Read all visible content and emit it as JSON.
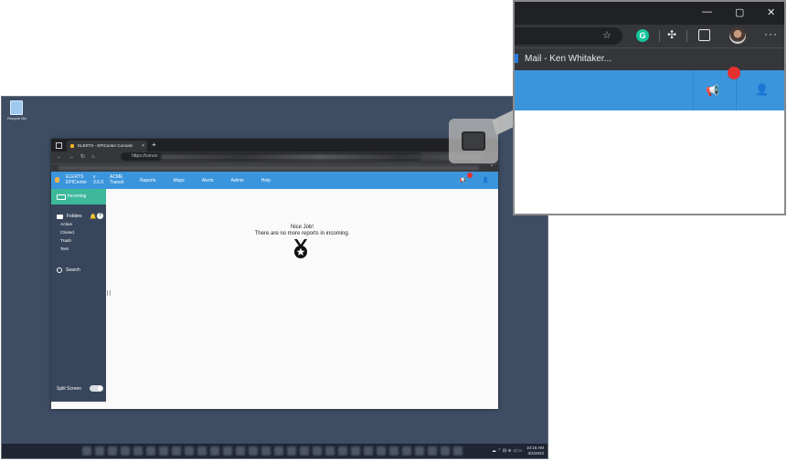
{
  "desktop": {
    "recycle_bin": "Recycle Bin",
    "clock_time": "10:16 AM",
    "clock_date": "3/4/2022"
  },
  "browser": {
    "tab_title": "ELERTS - EPICenter Console",
    "tab_close": "×",
    "new_tab": "+",
    "nav_glyphs": "←→↻⌂",
    "url": "https://conso"
  },
  "app": {
    "brand_line1": "ELERTS",
    "brand_line2": "EPICenter",
    "version_line1": "v",
    "version_line2": "3.6.0",
    "tenant_line1": "ACME",
    "tenant_line2": "Transit",
    "menu": [
      "Reports",
      "Maps",
      "Alerts",
      "Admin",
      "Help"
    ],
    "sidebar": {
      "incoming": "Incoming",
      "folders": "Folders",
      "help": "?",
      "folder_list": [
        "Active",
        "Closed",
        "Trash",
        "Test"
      ],
      "search": "Search",
      "split_screen": "Split Screen"
    },
    "main": {
      "headline": "Nice Job!",
      "message": "There are no more reports in incoming."
    }
  },
  "zoom": {
    "bookmark_label": "Mail - Ken Whitaker...",
    "window_controls": [
      "—",
      "▢",
      "✕"
    ],
    "more": "···",
    "grammarly": "G"
  },
  "colors": {
    "nav_blue": "#3b95dc",
    "incoming_green": "#3db89a",
    "sidebar_navy": "#37465b",
    "badge_red": "#e5312f"
  }
}
